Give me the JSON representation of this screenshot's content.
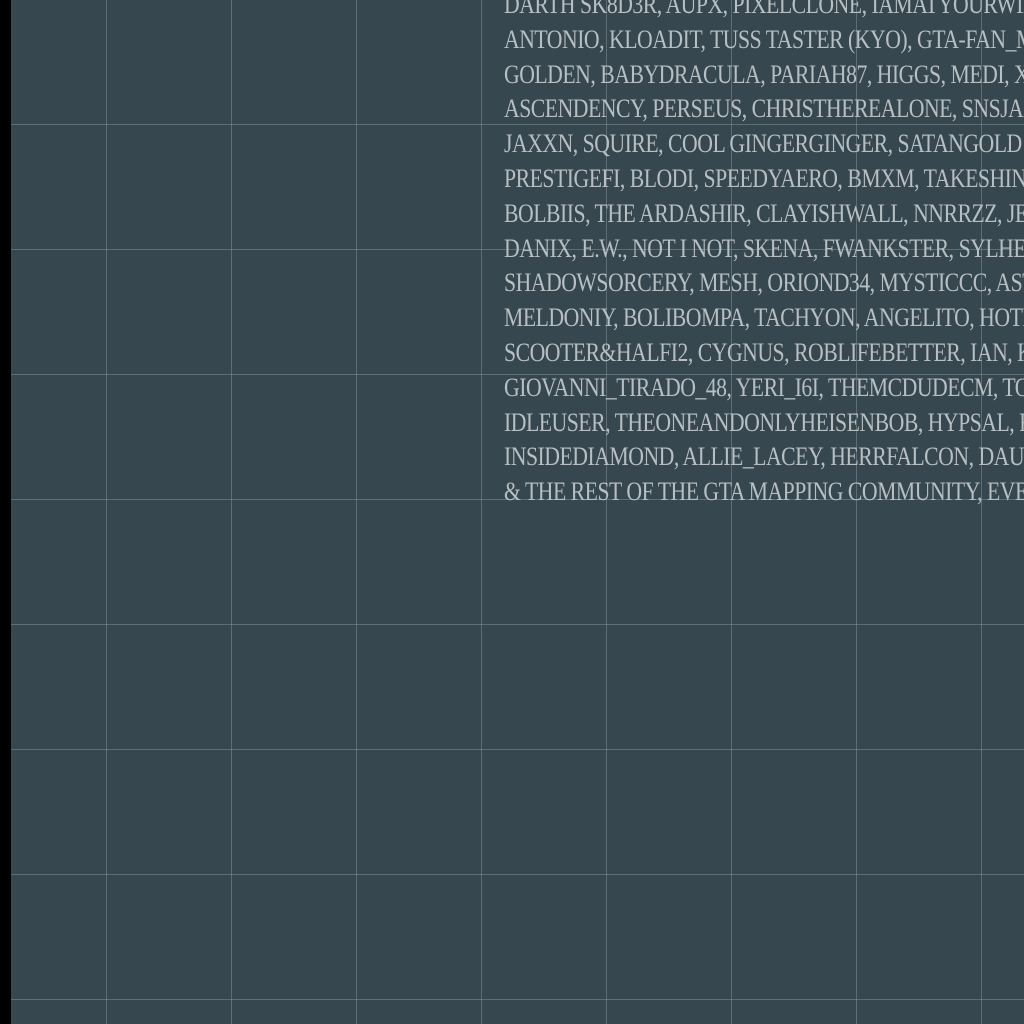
{
  "map": {
    "background_color": "#37474f",
    "grid_line_color": "#7f9098",
    "text_color": "#b7bfc3"
  },
  "credits": {
    "lines": [
      "DARTH SK8D3R, AUPX, PIXELCLONE, IAMATYOURWINDO",
      "ANTONIO, KLOADIT, TUSS TASTER (KYO), GTA-FAN_MADI",
      "GOLDEN, BABYDRACULA, PARIAH87, HIGGS, MEDI, XL JAW",
      "ASCENDENCY, PERSEUS, CHRISTHEREALONE, SNSJACKZ,",
      "JAXXN, SQUIRE, COOL GINGERGINGER, SATANGOLD!, JUZ",
      "PRESTIGEFI, BLODI, SPEEDYAERO, BMXM, TAKESHINO, C",
      "BOLBIIS, THE ARDASHIR, CLAYISHWALL, NNRRZZ, JEHU, J",
      "DANIX, E.W., NOT I NOT, SKENA, FWANKSTER, SYLHES, VI",
      "SHADOWSORCERY, MESH, ORIOND34, MYSTICCC, ASTON",
      "MELDONIY, BOLIBOMPA, TACHYON, ANGELITO, HOTEL T",
      "SCOOTER&HALFI2, CYGNUS, ROBLIFEBETTER, IAN, KIND",
      "GIOVANNI_TIRADO_48, YERI_I6I, THEMCDUDECM, TOPE",
      "IDLEUSER, THEONEANDONLYHEISENBOB, HYPSAL, FROS",
      "INSIDEDIAMOND, ALLIE_LACEY, HERRFALCON, DAUBY, Z",
      "& THE REST OF THE GTA MAPPING COMMUNITY, EVERY S"
    ]
  }
}
